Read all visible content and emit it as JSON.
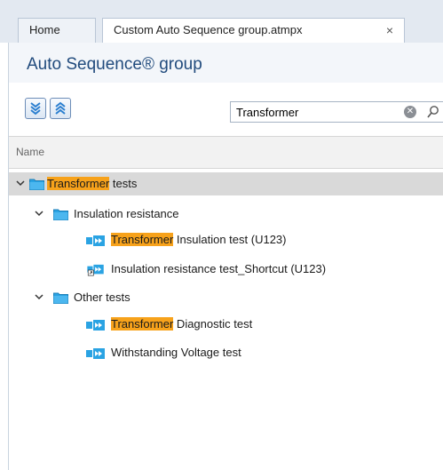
{
  "tabs": [
    {
      "label": "Home"
    },
    {
      "label": "Custom Auto Sequence group.atmpx",
      "close": "×"
    }
  ],
  "header": {
    "title": "Auto Sequence® group"
  },
  "toolbar": {
    "expand_icon": "expand-all-icon",
    "collapse_icon": "collapse-all-icon",
    "search": {
      "value": "Transformer",
      "clear_icon": "clear-icon",
      "search_icon": "magnifier-icon"
    }
  },
  "grid": {
    "column": "Name"
  },
  "tree": {
    "root": {
      "highlight": "Transformer",
      "rest": " tests",
      "expanded": true,
      "selected": true
    },
    "groups": [
      {
        "label": "Insulation resistance",
        "expanded": true,
        "items": [
          {
            "highlight": "Transformer",
            "rest": " Insulation test (U123)",
            "shortcut": false
          },
          {
            "highlight": "",
            "rest": "Insulation resistance test_Shortcut (U123)",
            "shortcut": true
          }
        ]
      },
      {
        "label": "Other tests",
        "expanded": true,
        "items": [
          {
            "highlight": "Transformer",
            "rest": " Diagnostic test",
            "shortcut": false
          },
          {
            "highlight": "",
            "rest": "Withstanding Voltage test",
            "shortcut": false
          }
        ]
      }
    ]
  },
  "colors": {
    "highlight": "#f7a21b",
    "folder": "#2aa3e3",
    "accent": "#214b7d",
    "selected_row": "#d9d9d9"
  }
}
